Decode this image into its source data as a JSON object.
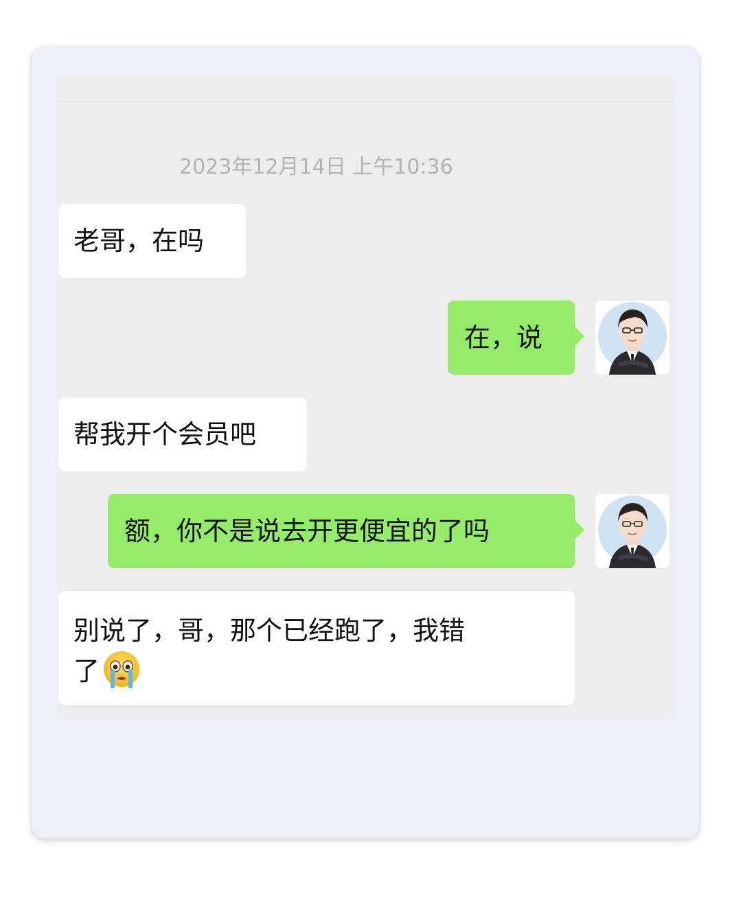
{
  "chat": {
    "timestamp": "2023年12月14日 上午10:36",
    "messages": [
      {
        "side": "in",
        "text": "老哥，在吗"
      },
      {
        "side": "out",
        "text": "在，说",
        "avatar": "user-avatar-icon"
      },
      {
        "side": "in",
        "text": "帮我开个会员吧"
      },
      {
        "side": "out",
        "text": "额，你不是说去开更便宜的了吗",
        "avatar": "user-avatar-icon"
      },
      {
        "side": "in",
        "text": "别说了，哥，那个已经跑了，我错\n了",
        "emoji": "crying-face-emoji-icon"
      }
    ]
  },
  "colors": {
    "outgoing_bubble": "#95ec69",
    "incoming_bubble": "#ffffff",
    "chat_background": "#ededed",
    "card_background": "#eeeff8",
    "timestamp_text": "#b3b3b3"
  }
}
